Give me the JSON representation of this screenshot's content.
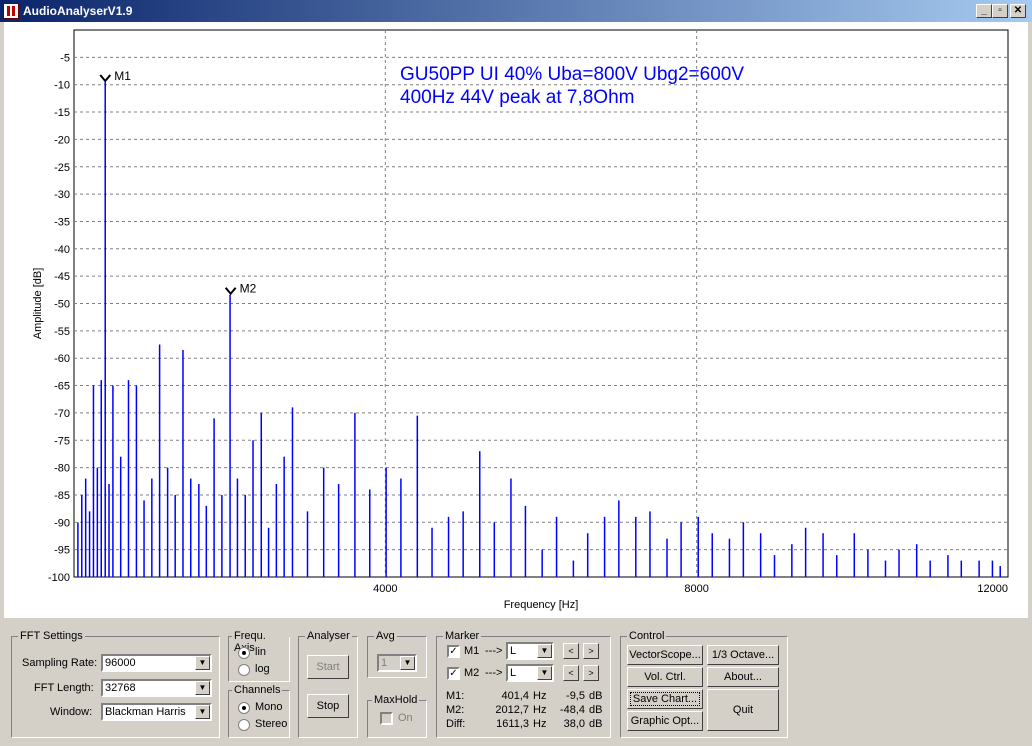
{
  "window": {
    "title": "AudioAnalyserV1.9",
    "min_btn": "_",
    "max_btn": "▫",
    "close_btn": "✕"
  },
  "chart_data": {
    "type": "line",
    "title_lines": [
      "GU50PP UI 40% Uba=800V Ubg2=600V",
      "400Hz 44V peak at 7,8Ohm"
    ],
    "xlabel": "Frequency [Hz]",
    "ylabel": "Amplitude [dB]",
    "xlim": [
      0,
      12000
    ],
    "ylim": [
      -100,
      0
    ],
    "x_ticks": [
      4000,
      8000,
      12000
    ],
    "x_tick_labels": [
      "4000",
      "8000",
      "12000"
    ],
    "y_ticks": [
      -5,
      -10,
      -15,
      -20,
      -25,
      -30,
      -35,
      -40,
      -45,
      -50,
      -55,
      -60,
      -65,
      -70,
      -75,
      -80,
      -85,
      -90,
      -95,
      -100
    ],
    "y_tick_labels": [
      "-5",
      "-10",
      "-15",
      "-20",
      "-25",
      "-30",
      "-35",
      "-40",
      "-45",
      "-50",
      "-55",
      "-60",
      "-65",
      "-70",
      "-75",
      "-80",
      "-85",
      "-90",
      "-95",
      "-100"
    ],
    "grid": true,
    "line_color": "#0000ff",
    "title_color": "#0000ff",
    "series": [
      {
        "x": [
          50,
          100,
          150,
          200,
          250,
          300,
          350,
          401,
          450,
          500,
          600,
          700,
          802,
          900,
          1000,
          1100,
          1203,
          1300,
          1400,
          1500,
          1604,
          1700,
          1800,
          1900,
          2005,
          2100,
          2200,
          2300,
          2406,
          2500,
          2600,
          2700,
          2807,
          3000,
          3208,
          3400,
          3609,
          3800,
          4010,
          4200,
          4411,
          4600,
          4812,
          5000,
          5213,
          5400,
          5614,
          5800,
          6015,
          6200,
          6416,
          6600,
          6817,
          7000,
          7218,
          7400,
          7619,
          7800,
          8020,
          8200,
          8421,
          8600,
          8822,
          9000,
          9223,
          9400,
          9624,
          9800,
          10025,
          10200,
          10426,
          10600,
          10827,
          11000,
          11228,
          11400,
          11629,
          11800,
          11900
        ],
        "y": [
          -90,
          -85,
          -82,
          -88,
          -65,
          -80,
          -64,
          -9.5,
          -83,
          -65,
          -78,
          -64,
          -65,
          -86,
          -82,
          -57.5,
          -80,
          -85,
          -58.5,
          -82,
          -83,
          -87,
          -71,
          -85,
          -48.4,
          -82,
          -85,
          -75,
          -70,
          -91,
          -83,
          -78,
          -69,
          -88,
          -80,
          -83,
          -70,
          -84,
          -80,
          -82,
          -70.5,
          -91,
          -89,
          -88,
          -77,
          -90,
          -82,
          -87,
          -95,
          -89,
          -97,
          -92,
          -89,
          -86,
          -89,
          -88,
          -93,
          -90,
          -89,
          -92,
          -93,
          -90,
          -92,
          -96,
          -94,
          -91,
          -92,
          -96,
          -92,
          -95,
          -97,
          -95,
          -94,
          -97,
          -96,
          -97,
          -97,
          -97,
          -98
        ]
      }
    ],
    "markers": [
      {
        "label": "M1",
        "x": 401.4,
        "y": -9.5
      },
      {
        "label": "M2",
        "x": 2012.7,
        "y": -48.4
      }
    ]
  },
  "fft": {
    "title": "FFT Settings",
    "sampling_rate_label": "Sampling Rate:",
    "sampling_rate": "96000",
    "fft_length_label": "FFT Length:",
    "fft_length": "32768",
    "window_label": "Window:",
    "window": "Blackman Harris"
  },
  "freq_axis": {
    "title": "Frequ. Axis",
    "lin": "lin",
    "log": "log",
    "selected": "lin"
  },
  "channels": {
    "title": "Channels",
    "mono": "Mono",
    "stereo": "Stereo",
    "selected": "Mono"
  },
  "analyser": {
    "title": "Analyser",
    "start": "Start",
    "stop": "Stop"
  },
  "avg": {
    "title": "Avg",
    "value": "1"
  },
  "maxhold": {
    "title": "MaxHold",
    "on": "On"
  },
  "marker": {
    "title": "Marker",
    "m1_label": "M1",
    "m1_arrow": "--->",
    "m1_channel": "L",
    "m2_label": "M2",
    "m2_arrow": "--->",
    "m2_channel": "L",
    "prev": "<",
    "next": ">",
    "rows": [
      {
        "name": "M1:",
        "freq": "401,4",
        "unit": "Hz",
        "db": "-9,5",
        "dbunit": "dB"
      },
      {
        "name": "M2:",
        "freq": "2012,7",
        "unit": "Hz",
        "db": "-48,4",
        "dbunit": "dB"
      },
      {
        "name": "Diff:",
        "freq": "1611,3",
        "unit": "Hz",
        "db": "38,0",
        "dbunit": "dB"
      }
    ]
  },
  "control": {
    "title": "Control",
    "vectorscope": "VectorScope...",
    "octave": "1/3 Octave...",
    "vol_ctrl": "Vol. Ctrl.",
    "about": "About...",
    "save_chart": "Save Chart...",
    "graphic_opt": "Graphic Opt...",
    "quit": "Quit"
  }
}
